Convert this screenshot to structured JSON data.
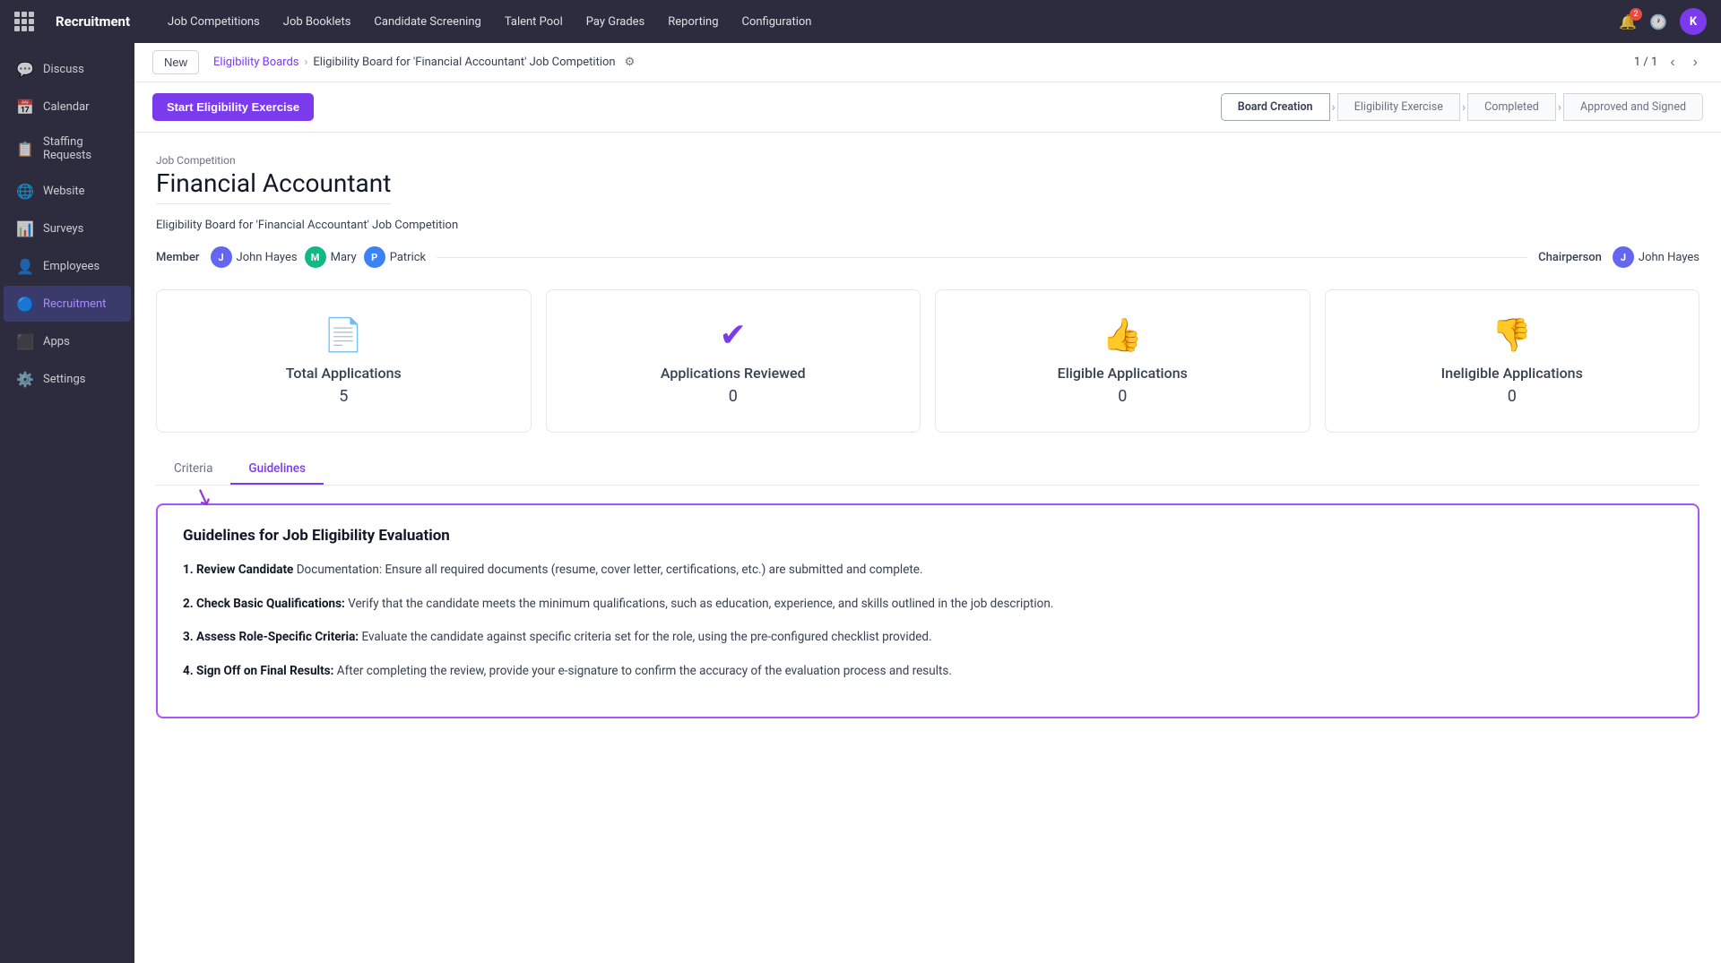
{
  "topNav": {
    "brand": "Recruitment",
    "links": [
      "Job Competitions",
      "Job Booklets",
      "Candidate Screening",
      "Talent Pool",
      "Pay Grades",
      "Reporting",
      "Configuration"
    ],
    "notificationCount": "2",
    "avatarLabel": "K"
  },
  "sidebar": {
    "items": [
      {
        "id": "discuss",
        "label": "Discuss",
        "icon": "💬"
      },
      {
        "id": "calendar",
        "label": "Calendar",
        "icon": "📅"
      },
      {
        "id": "staffing-requests",
        "label": "Staffing Requests",
        "icon": "📋"
      },
      {
        "id": "website",
        "label": "Website",
        "icon": "🌐"
      },
      {
        "id": "surveys",
        "label": "Surveys",
        "icon": "📊"
      },
      {
        "id": "employees",
        "label": "Employees",
        "icon": "👤"
      },
      {
        "id": "recruitment",
        "label": "Recruitment",
        "icon": "🔵",
        "active": true
      },
      {
        "id": "apps",
        "label": "Apps",
        "icon": "⚙️"
      },
      {
        "id": "settings",
        "label": "Settings",
        "icon": "⚙️"
      }
    ]
  },
  "breadcrumb": {
    "new_label": "New",
    "parent": "Eligibility Boards",
    "current": "Eligibility Board for 'Financial Accountant' Job Competition"
  },
  "pagination": {
    "text": "1 / 1"
  },
  "actionBar": {
    "start_button": "Start Eligibility Exercise",
    "workflow": [
      {
        "label": "Board Creation",
        "active": true
      },
      {
        "label": "Eligibility Exercise",
        "active": false
      },
      {
        "label": "Completed",
        "active": false
      },
      {
        "label": "Approved and Signed",
        "active": false
      }
    ]
  },
  "jobSection": {
    "fieldLabel": "Job Competition",
    "jobTitle": "Financial Accountant",
    "description": "Eligibility Board for 'Financial Accountant' Job Competition",
    "membersLabel": "Member",
    "members": [
      {
        "name": "John Hayes",
        "initial": "J",
        "color": "#6366f1"
      },
      {
        "name": "Mary",
        "initial": "M",
        "color": "#10b981"
      },
      {
        "name": "Patrick",
        "initial": "P",
        "color": "#3b82f6"
      }
    ],
    "chairpersonLabel": "Chairperson",
    "chairperson": {
      "name": "John Hayes",
      "initial": "J",
      "color": "#6366f1"
    }
  },
  "stats": [
    {
      "id": "total-applications",
      "label": "Total Applications",
      "value": "5",
      "icon": "📄"
    },
    {
      "id": "applications-reviewed",
      "label": "Applications Reviewed",
      "value": "0",
      "icon": "✔️"
    },
    {
      "id": "eligible-applications",
      "label": "Eligible Applications",
      "value": "0",
      "icon": "👍"
    },
    {
      "id": "ineligible-applications",
      "label": "Ineligible Applications",
      "value": "0",
      "icon": "👎"
    }
  ],
  "tabs": [
    {
      "label": "Criteria",
      "active": false
    },
    {
      "label": "Guidelines",
      "active": true
    }
  ],
  "guidelines": {
    "title": "Guidelines for Job Eligibility Evaluation",
    "items": [
      {
        "number": "1",
        "boldText": "Review Candidate",
        "text": " Documentation: Ensure all required documents (resume, cover letter, certifications, etc.) are submitted and complete."
      },
      {
        "number": "2",
        "boldText": "Check Basic Qualifications:",
        "text": " Verify that the candidate meets the minimum qualifications, such as education, experience, and skills outlined in the job description."
      },
      {
        "number": "3",
        "boldText": "Assess Role-Specific Criteria:",
        "text": " Evaluate the candidate against specific criteria set for the role, using the pre-configured checklist provided."
      },
      {
        "number": "4",
        "boldText": "Sign Off on Final Results:",
        "text": " After completing the review, provide your e-signature to confirm the accuracy of the evaluation process and results."
      }
    ]
  }
}
